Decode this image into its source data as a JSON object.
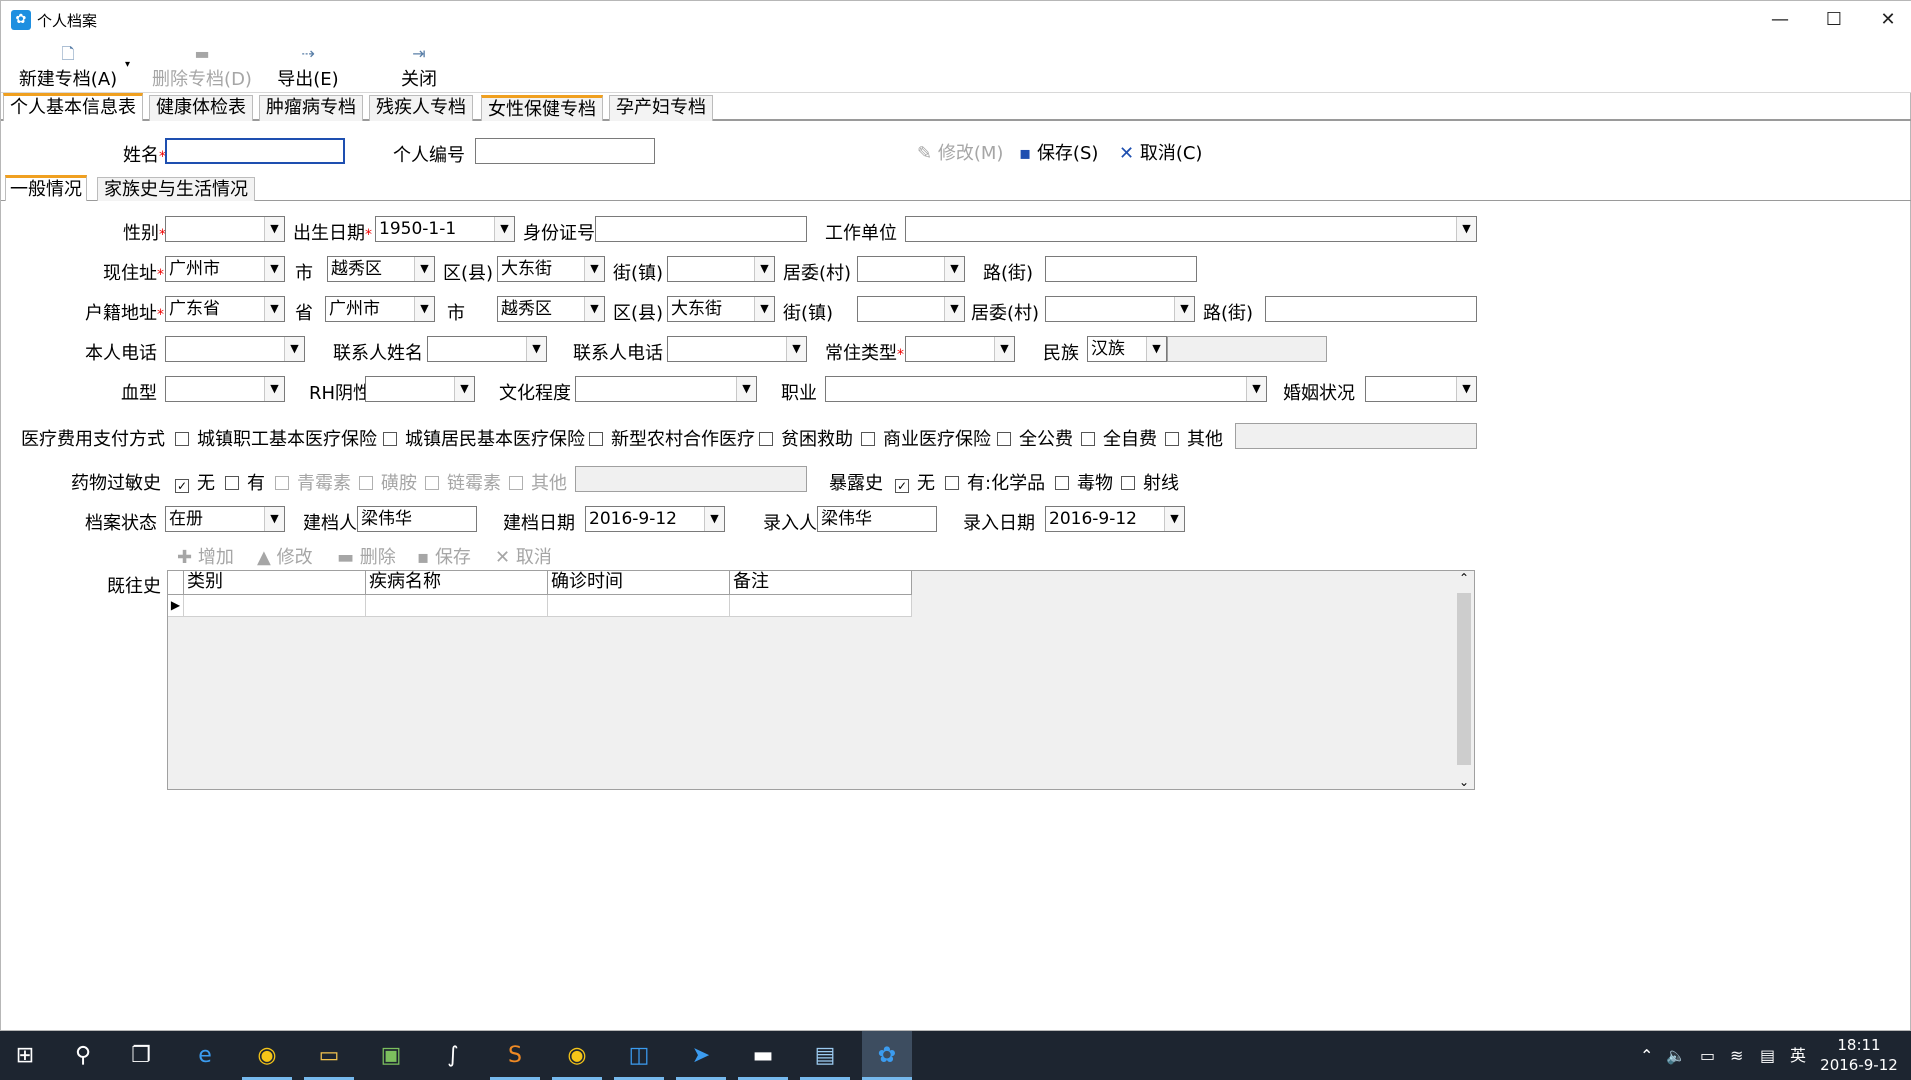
{
  "window": {
    "title": "个人档案",
    "app_icon": "app-icon",
    "btn_min": "—",
    "btn_max": "☐",
    "btn_close": "✕"
  },
  "toolbar": {
    "new": {
      "label": "新建专档(A)",
      "icon": "document-new-icon"
    },
    "delete": {
      "label": "删除专档(D)",
      "icon": "minus-icon"
    },
    "export": {
      "label": "导出(E)",
      "icon": "export-icon"
    },
    "close": {
      "label": "关闭",
      "icon": "exit-icon"
    }
  },
  "main_tabs": [
    "个人基本信息表",
    "健康体检表",
    "肿瘤病专档",
    "残疾人专档",
    "女性保健专档",
    "孕产妇专档"
  ],
  "header": {
    "name_label": "姓名",
    "name_value": "",
    "id_label": "个人编号",
    "id_value": "",
    "modify_btn": "修改(M)",
    "save_btn": "保存(S)",
    "cancel_btn": "取消(C)"
  },
  "sub_tabs": [
    "一般情况",
    "家族史与生活情况"
  ],
  "form": {
    "gender_label": "性别",
    "gender_value": "",
    "birth_label": "出生日期",
    "birth_value": "1950-1-1",
    "idcard_label": "身份证号",
    "idcard_value": "",
    "workunit_label": "工作单位",
    "workunit_value": "",
    "addr_label": "现住址",
    "addr_city": "广州市",
    "addr_shi": "市",
    "addr_district": "越秀区",
    "addr_qu": "区(县)",
    "addr_street": "大东街",
    "addr_jie": "街(镇)",
    "addr_town": "",
    "addr_juwei": "居委(村)",
    "addr_village": "",
    "addr_lu": "路(街)",
    "addr_road": "",
    "hukou_label": "户籍地址",
    "hukou_province": "广东省",
    "hukou_sheng": "省",
    "hukou_city": "广州市",
    "hukou_shi": "市",
    "hukou_district": "越秀区",
    "hukou_qu": "区(县)",
    "hukou_street": "大东街",
    "hukou_jie": "街(镇)",
    "hukou_town": "",
    "hukou_juwei": "居委(村)",
    "hukou_village": "",
    "hukou_lu": "路(街)",
    "hukou_road": "",
    "phone_label": "本人电话",
    "contact_name_label": "联系人姓名",
    "contact_phone_label": "联系人电话",
    "residence_label": "常住类型",
    "ethnic_label": "民族",
    "ethnic_value": "汉族",
    "blood_label": "血型",
    "rh_label": "RH阴性",
    "edu_label": "文化程度",
    "job_label": "职业",
    "marital_label": "婚姻状况",
    "pay_label": "医疗费用支付方式",
    "pay_options": [
      "城镇职工基本医疗保险",
      "城镇居民基本医疗保险",
      "新型农村合作医疗",
      "贫困救助",
      "商业医疗保险",
      "全公费",
      "全自费",
      "其他"
    ],
    "allergy_label": "药物过敏史",
    "allergy_none": "无",
    "allergy_yes": "有",
    "allergy_opts": [
      "青霉素",
      "磺胺",
      "链霉素",
      "其他"
    ],
    "exposure_label": "暴露史",
    "exposure_none": "无",
    "exposure_chem": "有:化学品",
    "exposure_poison": "毒物",
    "exposure_radiation": "射线",
    "status_label": "档案状态",
    "status_value": "在册",
    "creator_label": "建档人",
    "creator_value": "梁伟华",
    "create_date_label": "建档日期",
    "create_date_value": "2016-9-12",
    "entry_label": "录入人",
    "entry_value": "梁伟华",
    "entry_date_label": "录入日期",
    "entry_date_value": "2016-9-12"
  },
  "history": {
    "label": "既往史",
    "buttons": {
      "add": "增加",
      "modify": "修改",
      "delete": "删除",
      "save": "保存",
      "cancel": "取消"
    },
    "columns": [
      "类别",
      "疾病名称",
      "确诊时间",
      "备注"
    ]
  },
  "taskbar": {
    "icons": [
      "windows-start-icon",
      "search-icon",
      "task-view-icon",
      "edge-icon",
      "chrome-icon",
      "file-explorer-icon",
      "app-icon",
      "pen-icon",
      "sublime-icon",
      "chrome-icon",
      "outlook-icon",
      "feishu-icon",
      "terminal-icon",
      "card-icon",
      "medical-app-icon"
    ],
    "ime": "英",
    "time": "18:11",
    "date": "2016-9-12"
  }
}
